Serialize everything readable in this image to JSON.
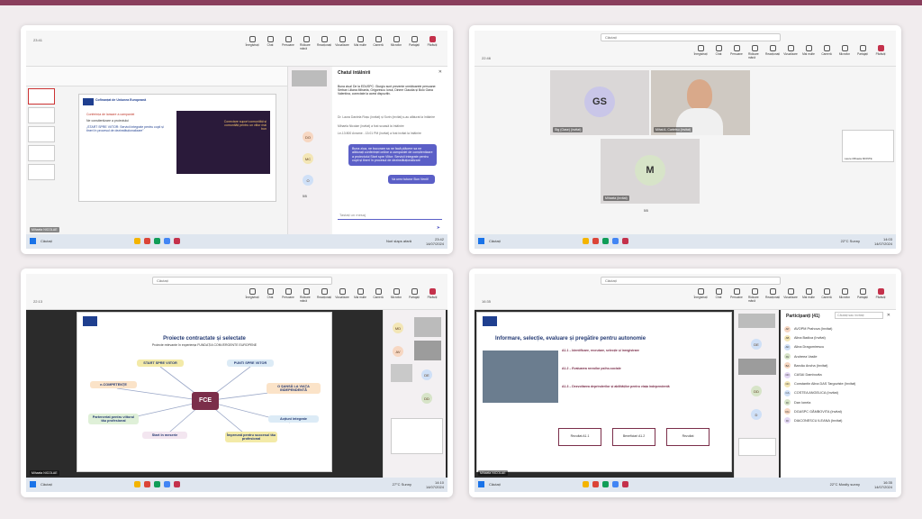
{
  "screens": [
    {
      "time": "23:41",
      "toolbar": [
        "Înregistrați",
        "Chat",
        "Persoane",
        "Ridicare mână",
        "Reacționați",
        "Vizualizare",
        "Mai multe",
        "Cameră",
        "Microfon",
        "Partajați",
        "Părăsiți"
      ],
      "participants_count": "23",
      "chat_title": "Chatul întâlnirii",
      "chat_messages": [
        "Buna ziua! De la EDUSPC: Giurgiu sunt prezente următoarele persoane: Serban Liliana Mihaela, Grigorescu Ionut, Dinme Claudia și Bolo Oana Valentina, conectate la acest dispozitiv.",
        "Dr. Laura Daniela Roșu (invitat) și Sorin (invitat) s-au alăturat la întâlnire",
        "Mihaela Nicolae (invitat) a fost scoasă la întâlnire",
        "Le-13:800 Avrame - 13:01 PM (invitat) a fost invitat la întâlnire"
      ],
      "chat_bubbles": [
        "Buna ziua, ne bucuram sa ne facă plăcere sa ne alăturați conferinței online a campaniei de conștientizare a proiectului Start spre Viitor: Servicii integrate pentru copii și tineri în procesul de dezinstituționalizare",
        "Va urez tuturor Bun Venit!"
      ],
      "chat_input_placeholder": "Tastați un mesaj",
      "chips": [
        "DO",
        "MC",
        "O"
      ],
      "slide_heading": "Cofinanțat de Uniunea Europeană",
      "slide_body": [
        "Conferința de lansare a campaniei",
        "Ne conștientizare a proiectului",
        "„START SPRE VIITOR: Servicii integrate pentru copii și tineri în procesul de dezinstituționalizare”",
        "Conectare suport comunități și comunități pentru un viitor mai bun"
      ],
      "slide_page": "5/5",
      "presenter": "Mihaela NICOLAE",
      "taskbar_search": "Căutați",
      "weather": "Nori slaps afară",
      "clock": [
        "23:42",
        "14/07/2024"
      ]
    },
    {
      "time": "22:46",
      "toolbar": [
        "Înregistrați",
        "Chat",
        "Persoane",
        "Ridicare mână",
        "Reacționați",
        "Vizualizare",
        "Mai multe",
        "Cameră",
        "Microfon",
        "Partajați",
        "Părăsiți"
      ],
      "search": "Căutați",
      "tiles": [
        {
          "initials": "GS",
          "label": "Stg (Oase) (invitat)"
        },
        {
          "initials": "",
          "label": "Mihai A. Cartetsu (invitat)"
        },
        {
          "initials": "M",
          "label": "Mihaela (invitat)"
        }
      ],
      "page": "5/5",
      "side_label": "Laure Mihaela MONTE",
      "taskbar_search": "Căutați",
      "weather": "22°C Sunny",
      "clock": [
        "14:03",
        "14/07/2024"
      ]
    },
    {
      "time": "22:13",
      "toolbar": [
        "Înregistrați",
        "Chat",
        "Persoane",
        "Ridicare mână",
        "Reacționați",
        "Vizualizare",
        "Mai multe",
        "Cameră",
        "Microfon",
        "Partajați",
        "Părăsiți"
      ],
      "search": "Căutați",
      "participants_count": "41",
      "slide_title": "Proiecte contractate și selectate",
      "slide_subtitle": "Proiecte relevante în experiența FUNDAȚIA CONVERGENTE EUROPENE",
      "center_node": "FCE",
      "nodes": [
        "START SPRE VIITOR",
        "PUNTI SPRE VIITOR",
        "e-COMPETENȚE",
        "O ȘANSĂ LA VIAȚA INDEPENDENTĂ",
        "Parteneriat pentru viitorul tău profesional",
        "Acțiuni integrate",
        "Start în meserie",
        "Împreună pentru succesul tău profesional"
      ],
      "chips": [
        "MD",
        "AV",
        "DE",
        "DD"
      ],
      "presenter": "Mihaela NICOLAE",
      "taskbar_search": "Căutați",
      "weather": "27°C Sunny",
      "clock": [
        "14:10",
        "14/07/2024"
      ]
    },
    {
      "time": "16:35",
      "toolbar": [
        "Înregistrați",
        "Chat",
        "Persoane",
        "Ridicare mână",
        "Reacționați",
        "Vizualizare",
        "Mai multe",
        "Cameră",
        "Microfon",
        "Partajați",
        "Părăsiți"
      ],
      "search": "Căutați",
      "participants_count": "41",
      "slide_title": "Informare, selecție, evaluare și pregătire pentru autonomie",
      "slide_sections": [
        "A1.1 – Identificare, recrutare, selecție și înregistrare",
        "A1.2 – Evaluarea nevoilor psiho-sociale",
        "A1.3 – Dezvoltarea deprinderilor și abilităților pentru viața independentă"
      ],
      "boxes": [
        "Rezultat A1.1",
        "Beneficiari A1.2",
        "Rezultat"
      ],
      "panel_title": "Participanți",
      "panel_count": "41",
      "invite_placeholder": "Căutați sau invitați",
      "people": [
        {
          "initials": "AP",
          "name": "AVOPM Prahova (Invitat)"
        },
        {
          "initials": "AB",
          "name": "Alina Badica (Invitat)"
        },
        {
          "initials": "AD",
          "name": "Alina Dragomirescu"
        },
        {
          "initials": "AV",
          "name": "Andreea Vasile"
        },
        {
          "initials": "BA",
          "name": "Barcău Ancha (Invitat)"
        },
        {
          "initials": "CD",
          "name": "CASAI Dambovita"
        },
        {
          "initials": "CD",
          "name": "Constantin Alina DAS Targoviste (Invitat)"
        },
        {
          "initials": "CA",
          "name": "COSTEA ANGELICA (Invitat)"
        },
        {
          "initials": "DI",
          "name": "Dan Ionela"
        },
        {
          "initials": "DG",
          "name": "DGASPC GĂMBOVITA (Invitat)"
        },
        {
          "initials": "DI",
          "name": "DIACONESCU ILEANA (Invitat)"
        }
      ],
      "chips": [
        "DE",
        "DD",
        "D"
      ],
      "presenter": "Mihaela NICOLAE",
      "taskbar_search": "Căutați",
      "weather": "22°C Mostly sunny",
      "clock": [
        "16:35",
        "14/07/2024"
      ]
    }
  ],
  "colors": {
    "accent": "#5b5fc7",
    "leave": "#c4314b",
    "brand": "#8a3e5c",
    "eu_blue": "#1f3f8f"
  }
}
